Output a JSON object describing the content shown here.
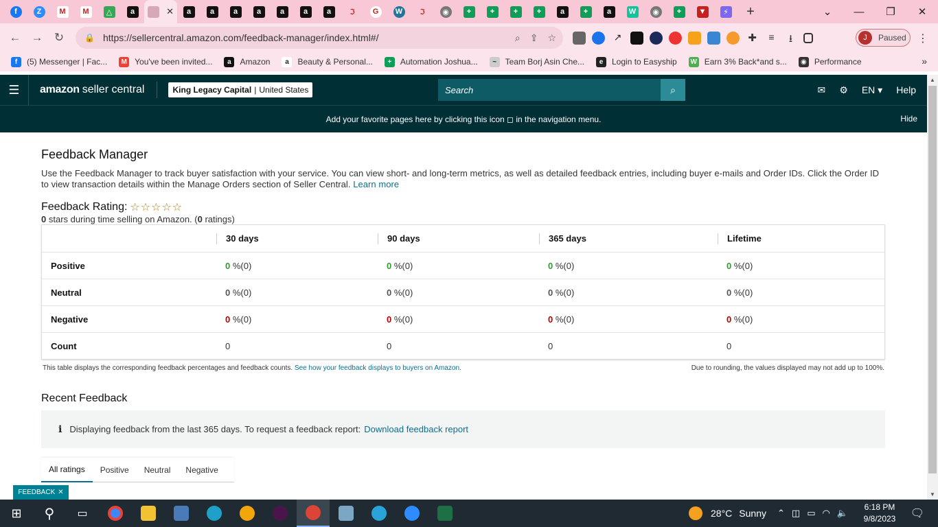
{
  "browser": {
    "tab_favicons": [
      "facebook",
      "zoom",
      "gmail",
      "gmail",
      "drive",
      "amazon",
      "active",
      "amazon",
      "amazon",
      "amazon",
      "amazon",
      "amazon",
      "amazon",
      "amazon",
      "teachable",
      "google",
      "wordpress",
      "teachable",
      "chrome",
      "sheets",
      "sheets",
      "sheets",
      "sheets",
      "amazon",
      "sheets",
      "amazon",
      "grammarly",
      "chrome",
      "sheets",
      "vpn",
      "clickup"
    ],
    "active_tab_close": "✕",
    "new_tab": "+",
    "window_controls": [
      "⌄",
      "—",
      "❐",
      "✕"
    ],
    "url": "https://sellercentral.amazon.com/feedback-manager/index.html#/",
    "profile_initial": "J",
    "profile_status": "Paused",
    "bookmarks": [
      {
        "label": "(5) Messenger | Fac...",
        "color": "#1877f2",
        "glyph": "f"
      },
      {
        "label": "You've been invited...",
        "color": "#ea4335",
        "glyph": "M"
      },
      {
        "label": "Amazon",
        "color": "#111111",
        "glyph": "a"
      },
      {
        "label": "Beauty & Personal...",
        "color": "#ffffff",
        "glyph": "a"
      },
      {
        "label": "Automation Joshua...",
        "color": "#0f9d58",
        "glyph": "+"
      },
      {
        "label": "Team Borj Asin Che...",
        "color": "#cccccc",
        "glyph": "~"
      },
      {
        "label": "Login to Easyship",
        "color": "#222222",
        "glyph": "e"
      },
      {
        "label": "Earn 3% Back*and s...",
        "color": "#4caf50",
        "glyph": "W"
      },
      {
        "label": "Performance",
        "color": "#333333",
        "glyph": "◉"
      }
    ],
    "bookmarks_more": "»"
  },
  "header": {
    "logo_bold": "amazon",
    "logo_rest": "seller central",
    "account_name": "King Legacy Capital",
    "account_region": "United States",
    "search_placeholder": "Search",
    "language": "EN",
    "help": "Help"
  },
  "favorites_bar": {
    "message": "Add your favorite pages here by clicking this icon ◻ in the navigation menu.",
    "hide": "Hide"
  },
  "page": {
    "title": "Feedback Manager",
    "description": "Use the Feedback Manager to track buyer satisfaction with your service. You can view short- and long-term metrics, as well as detailed feedback entries, including buyer e-mails and Order IDs. Click the Order ID to view transaction details within the Manage Orders section of Seller Central.",
    "learn_more": "Learn more",
    "rating_label": "Feedback Rating:",
    "stars": "☆☆☆☆☆",
    "rating_stars_value": "0",
    "rating_sub_mid": " stars during time selling on Amazon. (",
    "rating_count": "0",
    "rating_sub_end": " ratings)"
  },
  "table": {
    "columns": [
      "",
      "30 days",
      "90 days",
      "365 days",
      "Lifetime"
    ],
    "rows": [
      {
        "label": "Positive",
        "cls": "green",
        "cells": [
          {
            "v": "0",
            "s": " %(0)"
          },
          {
            "v": "0",
            "s": " %(0)"
          },
          {
            "v": "0",
            "s": " %(0)"
          },
          {
            "v": "0",
            "s": " %(0)"
          }
        ]
      },
      {
        "label": "Neutral",
        "cls": "grey",
        "cells": [
          {
            "v": "0",
            "s": " %(0)"
          },
          {
            "v": "0",
            "s": " %(0)"
          },
          {
            "v": "0",
            "s": " %(0)"
          },
          {
            "v": "0",
            "s": " %(0)"
          }
        ]
      },
      {
        "label": "Negative",
        "cls": "red",
        "cells": [
          {
            "v": "0",
            "s": " %(0)"
          },
          {
            "v": "0",
            "s": " %(0)"
          },
          {
            "v": "0",
            "s": " %(0)"
          },
          {
            "v": "0",
            "s": " %(0)"
          }
        ]
      },
      {
        "label": "Count",
        "cls": "",
        "cells": [
          {
            "v": "0",
            "s": ""
          },
          {
            "v": "0",
            "s": ""
          },
          {
            "v": "0",
            "s": ""
          },
          {
            "v": "0",
            "s": ""
          }
        ]
      }
    ],
    "note_left": "This table displays the corresponding feedback percentages and feedback counts.",
    "note_left_link": "See how your feedback displays to buyers on Amazon.",
    "note_right": "Due to rounding, the values displayed may not add up to 100%."
  },
  "recent": {
    "title": "Recent Feedback",
    "info_text": "Displaying feedback from the last 365 days. To request a feedback report:",
    "info_link": "Download feedback report",
    "filter_tabs": [
      "All ratings",
      "Positive",
      "Neutral",
      "Negative"
    ]
  },
  "feedback_pill": {
    "label": "FEEDBACK",
    "close": "✕"
  },
  "taskbar": {
    "temperature": "28°C",
    "condition": "Sunny",
    "time": "6:18 PM",
    "date": "9/8/2023"
  }
}
